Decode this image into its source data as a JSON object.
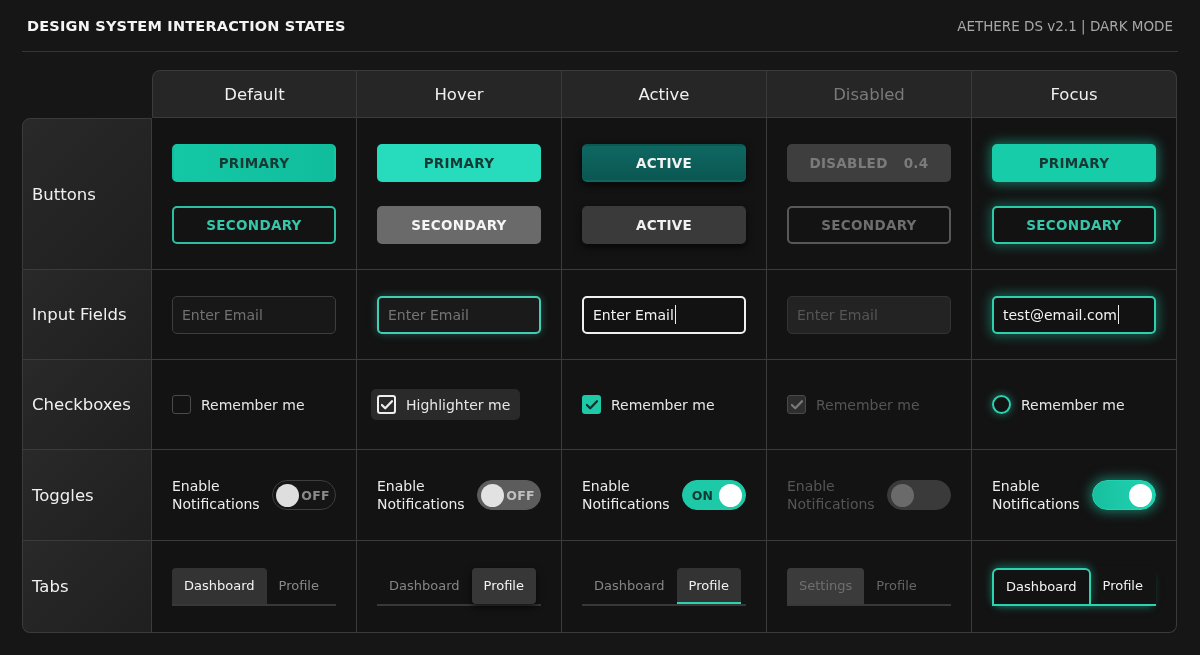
{
  "header": {
    "title": "DESIGN SYSTEM INTERACTION STATES",
    "subtitle": "AETHERE DS v2.1 | DARK MODE"
  },
  "columns": [
    {
      "label": "Default",
      "kind": "default"
    },
    {
      "label": "Hover",
      "kind": "hover"
    },
    {
      "label": "Active",
      "kind": "active"
    },
    {
      "label": "Disabled",
      "kind": "disabled"
    },
    {
      "label": "Focus",
      "kind": "focus"
    }
  ],
  "rows": [
    {
      "label": "Buttons",
      "kind": "buttons",
      "cells": [
        {
          "buttons": [
            {
              "kind": "primary",
              "label": "PRIMARY"
            },
            {
              "kind": "secondary",
              "label": "SECONDARY"
            }
          ]
        },
        {
          "buttons": [
            {
              "kind": "primary",
              "label": "PRIMARY"
            },
            {
              "kind": "secondary",
              "label": "SECONDARY"
            }
          ]
        },
        {
          "buttons": [
            {
              "kind": "primary",
              "label": "ACTIVE"
            },
            {
              "kind": "secondary",
              "label": "ACTIVE"
            }
          ]
        },
        {
          "buttons": [
            {
              "kind": "primary",
              "label": "DISABLED",
              "note": "0.4"
            },
            {
              "kind": "secondary",
              "label": "SECONDARY"
            }
          ]
        },
        {
          "buttons": [
            {
              "kind": "primary",
              "label": "PRIMARY"
            },
            {
              "kind": "secondary",
              "label": "SECONDARY"
            }
          ]
        }
      ]
    },
    {
      "label": "Input Fields",
      "kind": "inputs",
      "cells": [
        {
          "placeholder": "Enter Email"
        },
        {
          "placeholder": "Enter Email"
        },
        {
          "value": "Enter Email",
          "caret": true
        },
        {
          "placeholder": "Enter Email"
        },
        {
          "value": "test@email.com",
          "caret": true
        }
      ]
    },
    {
      "label": "Checkboxes",
      "kind": "checkboxes",
      "cells": [
        {
          "label": "Remember me",
          "checked": false
        },
        {
          "label": "Highlighter me",
          "checked": true
        },
        {
          "label": "Remember me",
          "checked": true
        },
        {
          "label": "Remember me",
          "checked": true
        },
        {
          "label": "Remember me",
          "checked": false
        }
      ]
    },
    {
      "label": "Toggles",
      "kind": "toggles",
      "cells": [
        {
          "label": "Enable Notifications",
          "on": false,
          "text": "OFF"
        },
        {
          "label": "Enable Notifications",
          "on": false,
          "text": "OFF"
        },
        {
          "label": "Enable Notifications",
          "on": true,
          "text": "ON"
        },
        {
          "label": "Enable Notifications",
          "on": false
        },
        {
          "label": "Enable Notifications",
          "on": true
        }
      ]
    },
    {
      "label": "Tabs",
      "kind": "tabs",
      "cells": [
        {
          "tabs": [
            {
              "label": "Dashboard",
              "selected": true
            },
            {
              "label": "Profile",
              "selected": false
            }
          ]
        },
        {
          "tabs": [
            {
              "label": "Dashboard",
              "selected": false
            },
            {
              "label": "Profile",
              "selected": true
            }
          ]
        },
        {
          "tabs": [
            {
              "label": "Dashboard",
              "selected": false
            },
            {
              "label": "Profile",
              "selected": true
            }
          ]
        },
        {
          "tabs": [
            {
              "label": "Settings",
              "selected": true
            },
            {
              "label": "Profile",
              "selected": false
            }
          ]
        },
        {
          "tabs": [
            {
              "label": "Dashboard",
              "selected": true
            },
            {
              "label": "Profile",
              "selected": false
            }
          ]
        }
      ]
    }
  ]
}
